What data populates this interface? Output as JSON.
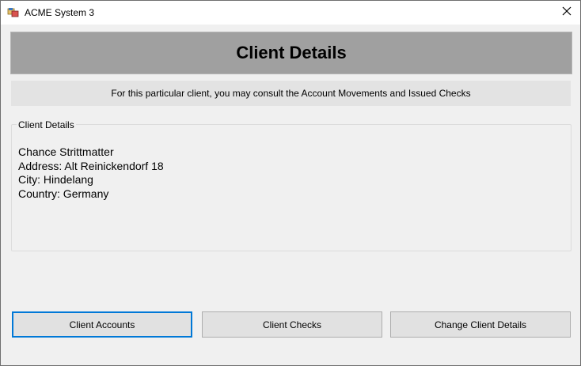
{
  "window": {
    "title": "ACME System 3",
    "app_icon": "app-window-icon",
    "close_icon": "close-icon"
  },
  "header": {
    "title": "Client Details"
  },
  "info": {
    "text": "For this particular client, you may consult the Account Movements and Issued Checks"
  },
  "client_group": {
    "legend": "Client Details",
    "name": "Chance Strittmatter",
    "address": "Address: Alt Reinickendorf 18",
    "city": "City: Hindelang",
    "country": "Country: Germany"
  },
  "buttons": {
    "accounts": "Client Accounts",
    "checks": "Client Checks",
    "change": "Change Client Details"
  },
  "colors": {
    "header_bg": "#a0a0a0",
    "focus_border": "#0078d7",
    "button_bg": "#e1e1e1"
  }
}
